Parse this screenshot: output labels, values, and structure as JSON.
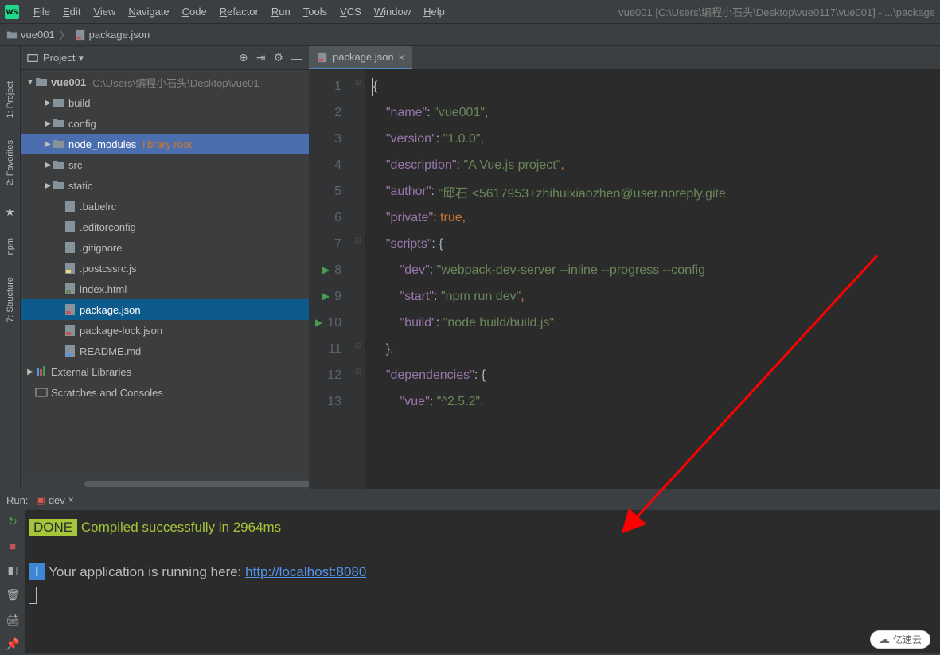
{
  "titlebar": {
    "logo": "WS",
    "menu": [
      "File",
      "Edit",
      "View",
      "Navigate",
      "Code",
      "Refactor",
      "Run",
      "Tools",
      "VCS",
      "Window",
      "Help"
    ],
    "title_right": "vue001 [C:\\Users\\编程小石头\\Desktop\\vue0117\\vue001] - ...\\package"
  },
  "breadcrumb": {
    "project": "vue001",
    "file": "package.json"
  },
  "project_panel": {
    "title": "Project"
  },
  "tree": {
    "root_name": "vue001",
    "root_path": "C:\\Users\\编程小石头\\Desktop\\vue01",
    "folders": [
      {
        "name": "build",
        "level": 2
      },
      {
        "name": "config",
        "level": 2
      },
      {
        "name": "node_modules",
        "level": 2,
        "hint": "library root",
        "lib": true
      },
      {
        "name": "src",
        "level": 2
      },
      {
        "name": "static",
        "level": 2
      }
    ],
    "files": [
      {
        "name": ".babelrc",
        "icon": "cfg"
      },
      {
        "name": ".editorconfig",
        "icon": "cfg"
      },
      {
        "name": ".gitignore",
        "icon": "cfg"
      },
      {
        "name": ".postcssrc.js",
        "icon": "js"
      },
      {
        "name": "index.html",
        "icon": "html"
      },
      {
        "name": "package.json",
        "icon": "json",
        "selected": true
      },
      {
        "name": "package-lock.json",
        "icon": "json"
      },
      {
        "name": "README.md",
        "icon": "md"
      }
    ],
    "external": "External Libraries",
    "scratches": "Scratches and Consoles"
  },
  "editor": {
    "tab": {
      "label": "package.json"
    },
    "lines": [
      {
        "n": 1,
        "tokens": [
          {
            "t": "{",
            "c": "brace"
          }
        ],
        "fold": "open",
        "cursor": true
      },
      {
        "n": 2,
        "indent": 2,
        "tokens": [
          {
            "t": "\"name\"",
            "c": "key"
          },
          {
            "t": ": ",
            "c": "brace"
          },
          {
            "t": "\"vue001\"",
            "c": "str"
          },
          {
            "t": ",",
            "c": "punc"
          }
        ]
      },
      {
        "n": 3,
        "indent": 2,
        "tokens": [
          {
            "t": "\"version\"",
            "c": "key"
          },
          {
            "t": ": ",
            "c": "brace"
          },
          {
            "t": "\"1.0.0\"",
            "c": "str"
          },
          {
            "t": ",",
            "c": "punc"
          }
        ]
      },
      {
        "n": 4,
        "indent": 2,
        "tokens": [
          {
            "t": "\"description\"",
            "c": "key"
          },
          {
            "t": ": ",
            "c": "brace"
          },
          {
            "t": "\"A Vue.js project\"",
            "c": "str"
          },
          {
            "t": ",",
            "c": "punc"
          }
        ]
      },
      {
        "n": 5,
        "indent": 2,
        "tokens": [
          {
            "t": "\"author\"",
            "c": "key"
          },
          {
            "t": ": ",
            "c": "brace"
          },
          {
            "t": "\"邱石 <5617953+zhihuixiaozhen@user.noreply.gite",
            "c": "str"
          }
        ]
      },
      {
        "n": 6,
        "indent": 2,
        "tokens": [
          {
            "t": "\"private\"",
            "c": "key"
          },
          {
            "t": ": ",
            "c": "brace"
          },
          {
            "t": "true",
            "c": "bool"
          },
          {
            "t": ",",
            "c": "punc"
          }
        ]
      },
      {
        "n": 7,
        "indent": 2,
        "tokens": [
          {
            "t": "\"scripts\"",
            "c": "key"
          },
          {
            "t": ": ",
            "c": "brace"
          },
          {
            "t": "{",
            "c": "brace"
          }
        ],
        "fold": "open"
      },
      {
        "n": 8,
        "indent": 4,
        "run": true,
        "tokens": [
          {
            "t": "\"dev\"",
            "c": "key"
          },
          {
            "t": ": ",
            "c": "brace"
          },
          {
            "t": "\"webpack-dev-server --inline --progress --config",
            "c": "str"
          }
        ]
      },
      {
        "n": 9,
        "indent": 4,
        "run": true,
        "tokens": [
          {
            "t": "\"start\"",
            "c": "key"
          },
          {
            "t": ": ",
            "c": "brace"
          },
          {
            "t": "\"npm run dev\"",
            "c": "str"
          },
          {
            "t": ",",
            "c": "punc"
          }
        ]
      },
      {
        "n": 10,
        "indent": 4,
        "run": true,
        "tokens": [
          {
            "t": "\"build\"",
            "c": "key"
          },
          {
            "t": ": ",
            "c": "brace"
          },
          {
            "t": "\"node build/build.js\"",
            "c": "str"
          }
        ]
      },
      {
        "n": 11,
        "indent": 2,
        "tokens": [
          {
            "t": "}",
            "c": "brace"
          },
          {
            "t": ",",
            "c": "punc"
          }
        ],
        "fold": "close"
      },
      {
        "n": 12,
        "indent": 2,
        "tokens": [
          {
            "t": "\"dependencies\"",
            "c": "key"
          },
          {
            "t": ": ",
            "c": "brace"
          },
          {
            "t": "{",
            "c": "brace"
          }
        ],
        "fold": "open"
      },
      {
        "n": 13,
        "indent": 4,
        "tokens": [
          {
            "t": "\"vue\"",
            "c": "key"
          },
          {
            "t": ": ",
            "c": "brace"
          },
          {
            "t": "\"^2.5.2\"",
            "c": "str"
          },
          {
            "t": ",",
            "c": "punc"
          }
        ]
      }
    ]
  },
  "run": {
    "label": "Run:",
    "config": "dev",
    "done_badge": "DONE",
    "compiled": " Compiled successfully in 2964ms",
    "i_badge": "I",
    "running_msg": " Your application is running here: ",
    "url": "http://localhost:8080"
  },
  "watermark": "亿速云"
}
